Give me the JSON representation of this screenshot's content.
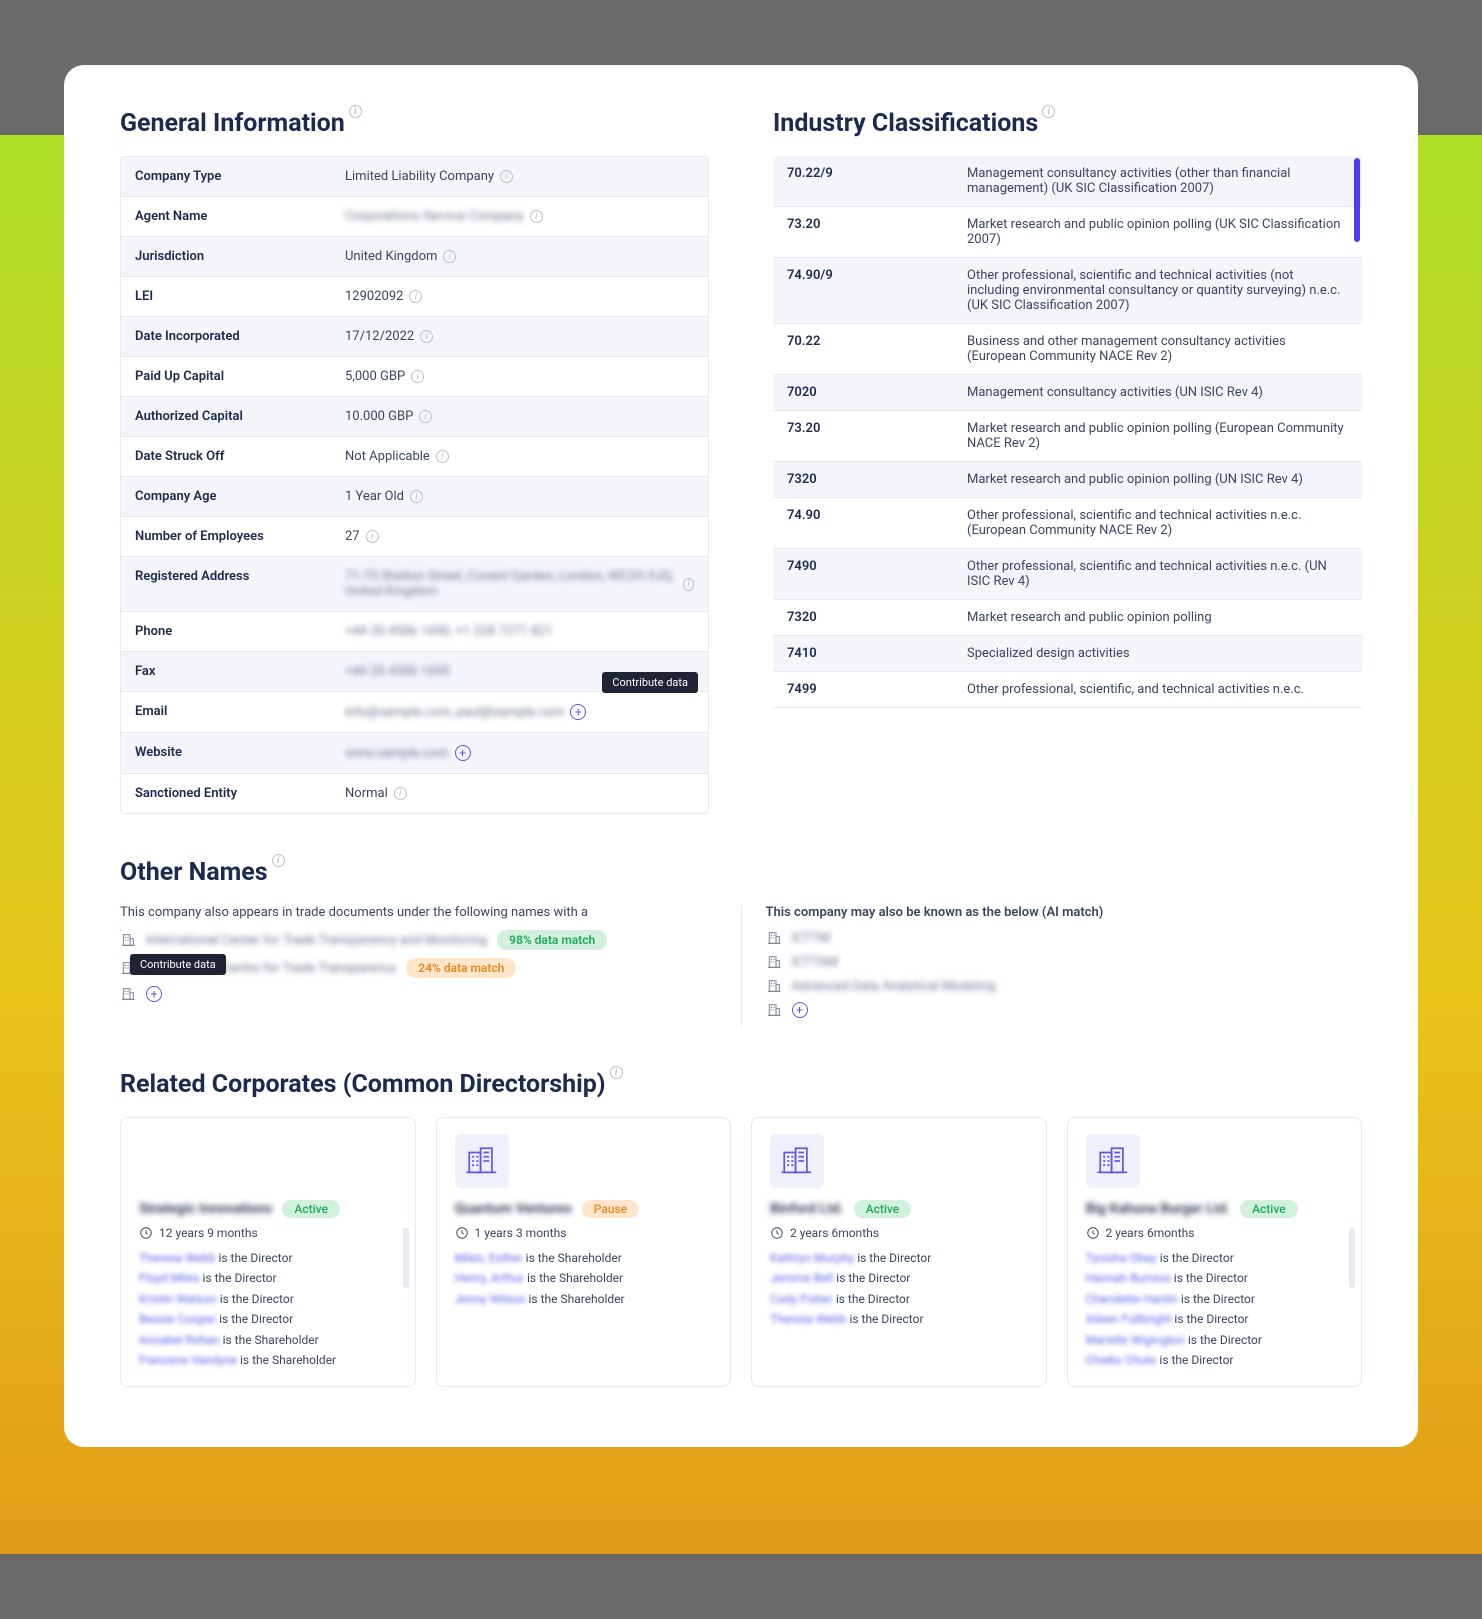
{
  "sections": {
    "general_info": "General Information",
    "industry": "Industry Classifications",
    "other_names": "Other Names",
    "related": "Related Corporates (Common Directorship)"
  },
  "general": [
    {
      "label": "Company Type",
      "value": "Limited Liability Company",
      "info": true
    },
    {
      "label": "Agent Name",
      "value": "Corporations Service Company",
      "blur": true,
      "info": true
    },
    {
      "label": "Jurisdiction",
      "value": "United Kingdom",
      "info": true
    },
    {
      "label": "LEI",
      "value": "12902092",
      "info": true
    },
    {
      "label": "Date Incorporated",
      "value": "17/12/2022",
      "info": true
    },
    {
      "label": "Paid Up Capital",
      "value": "5,000 GBP",
      "info": true
    },
    {
      "label": "Authorized Capital",
      "value": "10.000 GBP",
      "info": true
    },
    {
      "label": "Date Struck Off",
      "value": "Not Applicable",
      "info": true
    },
    {
      "label": "Company Age",
      "value": "1 Year Old",
      "info": true
    },
    {
      "label": "Number of Employees",
      "value": "27",
      "info": true
    },
    {
      "label": "Registered Address",
      "value": "71-75 Shelton Street, Covent Garden, London, WC2H 9JQ, United Kingdom",
      "blur": true,
      "info": true,
      "info_right": true
    },
    {
      "label": "Phone",
      "value": "+44 20 4586 1690, +1 228 7271 821",
      "blur": true
    },
    {
      "label": "Fax",
      "value": "+44 20 4586 1690",
      "blur": true
    },
    {
      "label": "Email",
      "value": "info@sample.com, paul@sample.com",
      "blur": true,
      "add": true,
      "tooltip": "Contribute data"
    },
    {
      "label": "Website",
      "value": "www.sample.com",
      "blur": true,
      "add": true
    },
    {
      "label": "Sanctioned Entity",
      "value": "Normal",
      "info": true
    }
  ],
  "industry": [
    {
      "code": "70.22/9",
      "desc": "Management consultancy activities (other than financial management) (UK SIC Classification 2007)"
    },
    {
      "code": "73.20",
      "desc": "Market research and public opinion polling (UK SIC Classification 2007)"
    },
    {
      "code": "74.90/9",
      "desc": "Other professional, scientific and technical activities (not including environmental consultancy or quantity surveying) n.e.c. (UK SIC Classification 2007)"
    },
    {
      "code": "70.22",
      "desc": "Business and other management consultancy activities (European Community NACE Rev 2)"
    },
    {
      "code": "7020",
      "desc": "Management consultancy activities (UN ISIC Rev 4)"
    },
    {
      "code": "73.20",
      "desc": "Market research and public opinion polling (European Community NACE Rev 2)"
    },
    {
      "code": "7320",
      "desc": "Market research and public opinion polling (UN ISIC Rev 4)"
    },
    {
      "code": "74.90",
      "desc": "Other professional, scientific and technical activities n.e.c. (European Community NACE Rev 2)"
    },
    {
      "code": "7490",
      "desc": "Other professional, scientific and technical activities n.e.c. (UN ISIC Rev 4)"
    },
    {
      "code": "7320",
      "desc": "Market research and public opinion polling"
    },
    {
      "code": "7410",
      "desc": "Specialized design activities"
    },
    {
      "code": "7499",
      "desc": "Other professional, scientific, and technical activities n.e.c."
    }
  ],
  "other_names": {
    "trade_intro": "This company also appears in trade documents under the following names with a",
    "ai_intro": "This company may also be known as the below (AI match)",
    "trade": [
      {
        "name": "International Center for Trade Transparency and Monitoring",
        "match": "98% data match",
        "match_class": "green"
      },
      {
        "name": "International Centre for Trade Transparency",
        "match": "24% data match",
        "match_class": "orange",
        "tooltip": "Contribute data"
      },
      {
        "add": true
      }
    ],
    "ai": [
      {
        "name": "ICTTM"
      },
      {
        "name": "ICTTAM"
      },
      {
        "name": "Advanced Data Analytical Modeling"
      },
      {
        "add": true
      }
    ]
  },
  "related": [
    {
      "name": "Strategic Innovations",
      "status": "Active",
      "status_class": "active",
      "age": "12 years 9 months",
      "no_icon": true,
      "people": [
        {
          "name": "Theresa Webb",
          "role": "is the Director"
        },
        {
          "name": "Floyd Miles",
          "role": "is the Director"
        },
        {
          "name": "Kristin Watson",
          "role": "is the Director"
        },
        {
          "name": "Bessie Cooper",
          "role": "is the Director"
        },
        {
          "name": "Annabel Rohan",
          "role": "is the Shareholder"
        },
        {
          "name": "Francene Vandyne",
          "role": "is the Shareholder"
        }
      ]
    },
    {
      "name": "Quantum Ventures",
      "status": "Pause",
      "status_class": "pause",
      "age": "1 years 3 months",
      "people": [
        {
          "name": "Miles, Esther",
          "role": "is the Shareholder"
        },
        {
          "name": "Henry, Arthur",
          "role": "is the Shareholder"
        },
        {
          "name": "Jenny Wilson",
          "role": "is the Shareholder"
        }
      ]
    },
    {
      "name": "Binford Ltd.",
      "status": "Active",
      "status_class": "active",
      "age": "2 years 6months",
      "people": [
        {
          "name": "Kathryn Murphy",
          "role": "is the Director"
        },
        {
          "name": "Jerome Bell",
          "role": "is the Director"
        },
        {
          "name": "Cody Fisher",
          "role": "is the Director"
        },
        {
          "name": "Theresa Webb",
          "role": "is the Director"
        }
      ]
    },
    {
      "name": "Big Kahuna Burger Ltd.",
      "status": "Active",
      "status_class": "active",
      "age": "2 years 6months",
      "people": [
        {
          "name": "Tynisha Obey",
          "role": "is the Director"
        },
        {
          "name": "Hannah Burress",
          "role": "is the Director"
        },
        {
          "name": "Charolette Hanlin",
          "role": "is the Director"
        },
        {
          "name": "Aileen Fullbright",
          "role": "is the Director"
        },
        {
          "name": "Marielle Wigington",
          "role": "is the Director"
        },
        {
          "name": "Chieko Chute",
          "role": "is the Director"
        }
      ]
    }
  ]
}
